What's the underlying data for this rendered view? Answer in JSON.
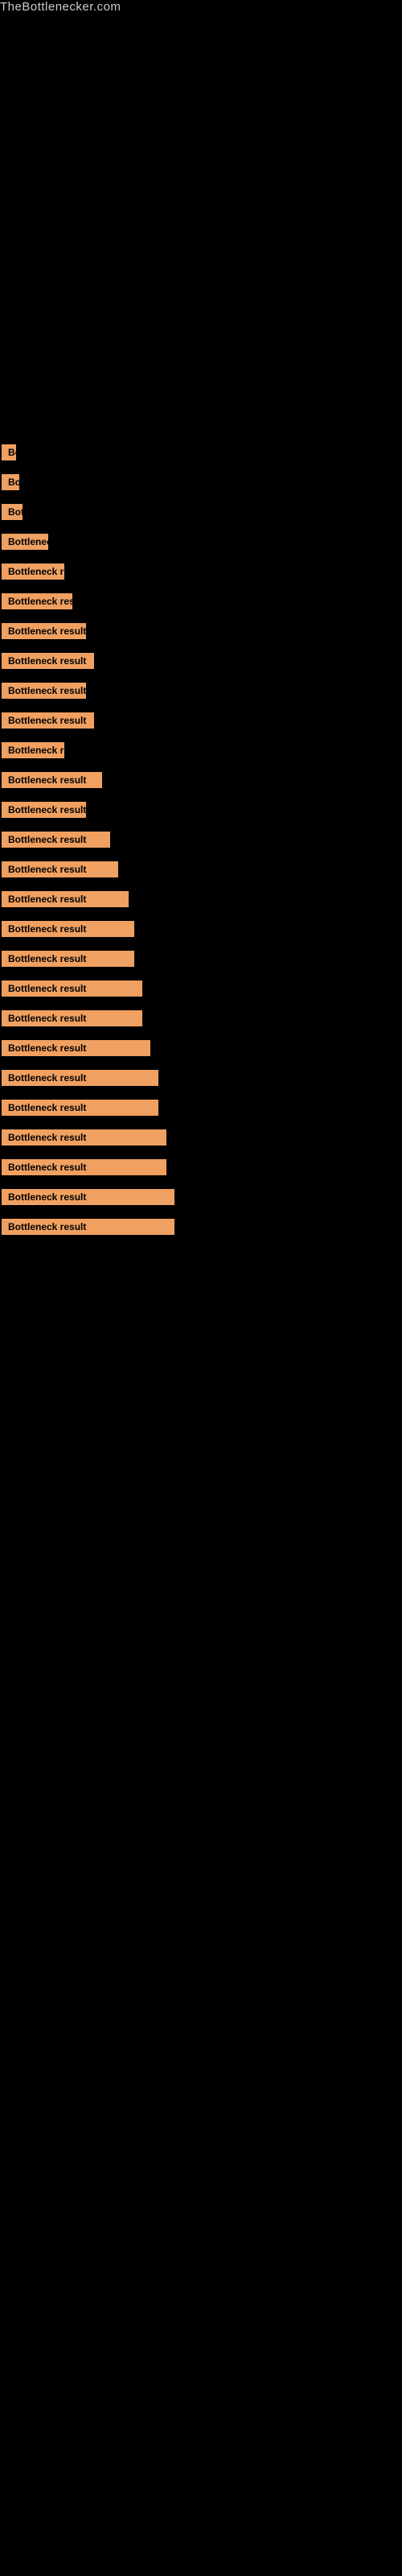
{
  "site": {
    "title": "TheBottlenecker.com"
  },
  "results": [
    {
      "label": "Bottleneck result",
      "width_class": "w-10"
    },
    {
      "label": "Bottleneck result",
      "width_class": "w-12"
    },
    {
      "label": "Bottleneck result",
      "width_class": "w-14"
    },
    {
      "label": "Bottleneck result",
      "width_class": "w-60"
    },
    {
      "label": "Bottleneck result",
      "width_class": "w-80"
    },
    {
      "label": "Bottleneck result",
      "width_class": "w-90"
    },
    {
      "label": "Bottleneck result",
      "width_class": "w-100"
    },
    {
      "label": "Bottleneck result",
      "width_class": "w-110"
    },
    {
      "label": "Bottleneck result",
      "width_class": "w-100"
    },
    {
      "label": "Bottleneck result",
      "width_class": "w-110"
    },
    {
      "label": "Bottleneck result",
      "width_class": "w-80"
    },
    {
      "label": "Bottleneck result",
      "width_class": "w-120"
    },
    {
      "label": "Bottleneck result",
      "width_class": "w-100"
    },
    {
      "label": "Bottleneck result",
      "width_class": "w-130"
    },
    {
      "label": "Bottleneck result",
      "width_class": "w-140"
    },
    {
      "label": "Bottleneck result",
      "width_class": "w-150"
    },
    {
      "label": "Bottleneck result",
      "width_class": "w-160"
    },
    {
      "label": "Bottleneck result",
      "width_class": "w-160"
    },
    {
      "label": "Bottleneck result",
      "width_class": "w-170"
    },
    {
      "label": "Bottleneck result",
      "width_class": "w-170"
    },
    {
      "label": "Bottleneck result",
      "width_class": "w-180"
    },
    {
      "label": "Bottleneck result",
      "width_class": "w-190"
    },
    {
      "label": "Bottleneck result",
      "width_class": "w-190"
    },
    {
      "label": "Bottleneck result",
      "width_class": "w-200"
    },
    {
      "label": "Bottleneck result",
      "width_class": "w-200"
    },
    {
      "label": "Bottleneck result",
      "width_class": "w-210"
    },
    {
      "label": "Bottleneck result",
      "width_class": "w-210"
    }
  ]
}
